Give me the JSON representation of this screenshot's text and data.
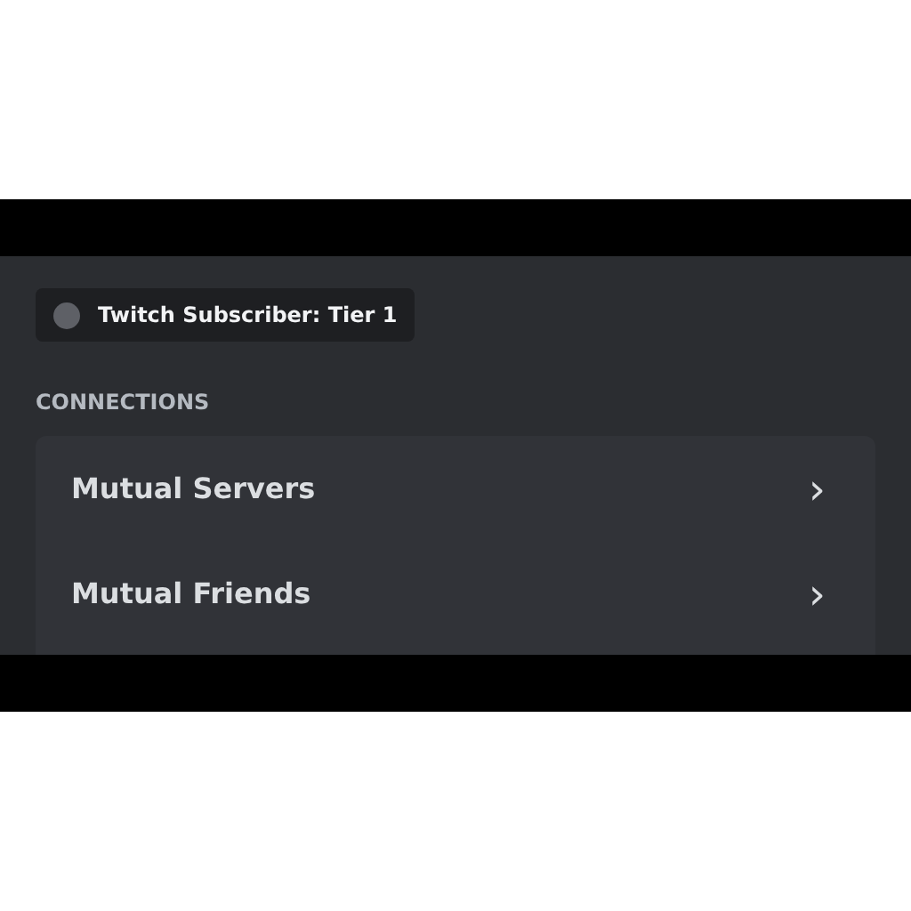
{
  "roles": [
    {
      "name": "Twitch Subscriber: Tier 1",
      "color": "#5e6066"
    }
  ],
  "connections": {
    "heading": "CONNECTIONS",
    "items": [
      {
        "label": "Mutual Servers",
        "chevron": "›"
      },
      {
        "label": "Mutual Friends",
        "chevron": "›"
      }
    ]
  }
}
